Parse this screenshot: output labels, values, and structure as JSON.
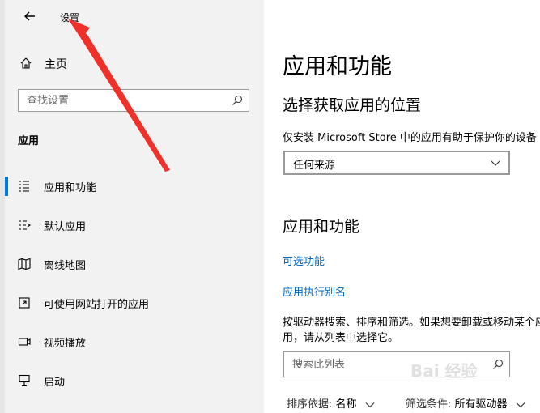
{
  "window": {
    "title": "设置"
  },
  "sidebar": {
    "home_label": "主页",
    "search_placeholder": "查找设置",
    "section_heading": "应用",
    "items": [
      {
        "label": "应用和功能",
        "icon": "apps-list-icon",
        "active": true
      },
      {
        "label": "默认应用",
        "icon": "default-apps-icon",
        "active": false
      },
      {
        "label": "离线地图",
        "icon": "offline-map-icon",
        "active": false
      },
      {
        "label": "可使用网站打开的应用",
        "icon": "website-apps-icon",
        "active": false
      },
      {
        "label": "视频播放",
        "icon": "video-playback-icon",
        "active": false
      },
      {
        "label": "启动",
        "icon": "startup-icon",
        "active": false
      }
    ]
  },
  "main": {
    "title": "应用和功能",
    "choose_heading": "选择获取应用的位置",
    "choose_desc": "仅安装 Microsoft Store 中的应用有助于保护你的设备",
    "source_dropdown_value": "任何来源",
    "apps_heading": "应用和功能",
    "optional_features_link": "可选功能",
    "app_alias_link": "应用执行别名",
    "list_desc": "按驱动器搜索、排序和筛选。如果想要卸载或移动某个应用，请从列表中选择它。",
    "list_search_placeholder": "搜索此列表",
    "sort_label": "排序依据:",
    "sort_value": "名称",
    "filter_label": "筛选条件:",
    "filter_value": "所有驱动器"
  },
  "colors": {
    "accent": "#0078d7",
    "link": "#0067c0",
    "annotation_arrow": "#f0312a"
  },
  "watermark_text": "Bai 经验"
}
